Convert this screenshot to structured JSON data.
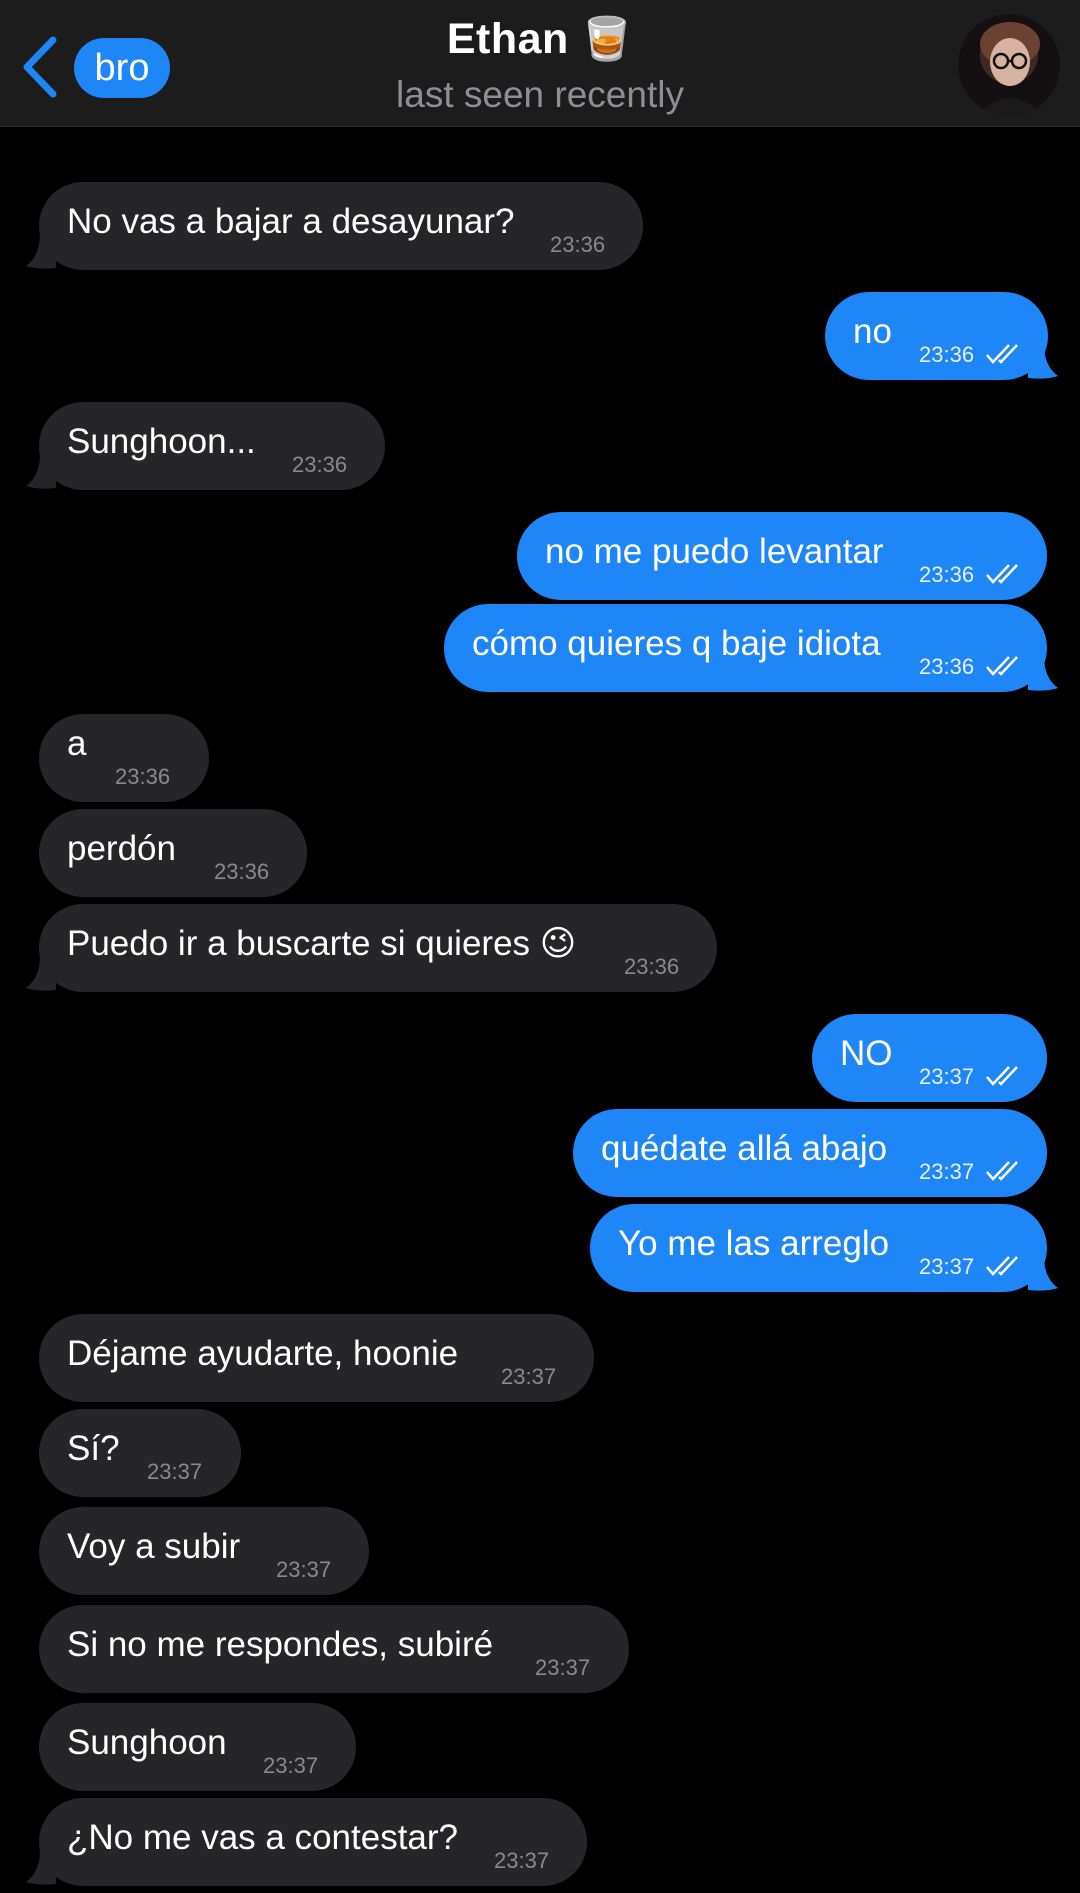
{
  "header": {
    "back_badge": "bro",
    "title": "Ethan",
    "title_emoji": "🥃",
    "subtitle": "last seen recently"
  },
  "messages": [
    {
      "dir": "in",
      "text": "No vas a bajar a desayunar?",
      "time": "23:36"
    },
    {
      "dir": "out",
      "text": "no",
      "time": "23:36",
      "read": true
    },
    {
      "dir": "in",
      "text": "Sunghoon...",
      "time": "23:36"
    },
    {
      "dir": "out",
      "text": "no me puedo levantar",
      "time": "23:36",
      "read": true
    },
    {
      "dir": "out",
      "text": "cómo quieres q baje idiota",
      "time": "23:36",
      "read": true
    },
    {
      "dir": "in",
      "text": "a",
      "time": "23:36"
    },
    {
      "dir": "in",
      "text": "perdón",
      "time": "23:36"
    },
    {
      "dir": "in",
      "text": "Puedo ir a buscarte si quieres 😉",
      "time": "23:36"
    },
    {
      "dir": "out",
      "text": "NO",
      "time": "23:37",
      "read": true
    },
    {
      "dir": "out",
      "text": "quédate allá abajo",
      "time": "23:37",
      "read": true
    },
    {
      "dir": "out",
      "text": "Yo me las arreglo",
      "time": "23:37",
      "read": true
    },
    {
      "dir": "in",
      "text": "Déjame ayudarte, hoonie",
      "time": "23:37"
    },
    {
      "dir": "in",
      "text": "Sí?",
      "time": "23:37"
    },
    {
      "dir": "in",
      "text": "Voy a subir",
      "time": "23:37"
    },
    {
      "dir": "in",
      "text": "Si no me respondes, subiré",
      "time": "23:37"
    },
    {
      "dir": "in",
      "text": "Sunghoon",
      "time": "23:37"
    },
    {
      "dir": "in",
      "text": "¿No me vas a contestar?",
      "time": "23:37"
    }
  ],
  "colors": {
    "incoming_bubble": "#262628",
    "outgoing_bubble": "#1e86f7",
    "accent": "#1e86f7",
    "background": "#000000"
  }
}
